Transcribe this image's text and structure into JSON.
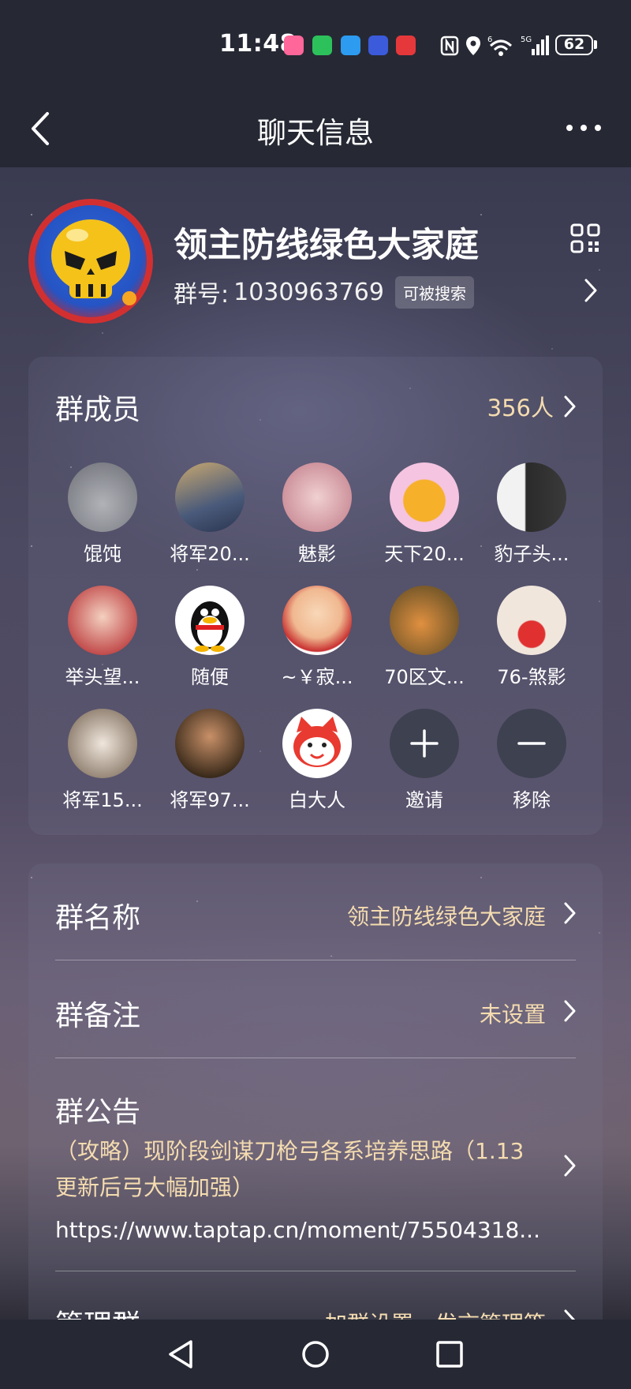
{
  "status_bar": {
    "time": "11:48",
    "app_icons": [
      {
        "name": "bilibili-icon",
        "color": "#ff6699",
        "glyph": "b"
      },
      {
        "name": "wechat-icon",
        "color": "#2dc15c",
        "glyph": "●"
      },
      {
        "name": "message-icon",
        "color": "#2d9bf0",
        "glyph": "●"
      },
      {
        "name": "tieba-icon",
        "color": "#3b5bdb",
        "glyph": "贴"
      },
      {
        "name": "vivo-icon",
        "color": "#e5383b",
        "glyph": "●"
      }
    ],
    "network": "5G",
    "wifi_label": "6",
    "battery": "62"
  },
  "nav": {
    "title": "聊天信息"
  },
  "group": {
    "name": "领主防线绿色大家庭",
    "id_label": "群号:",
    "id_value": "1030963769",
    "search_badge": "可被搜索"
  },
  "members": {
    "title": "群成员",
    "count": "356人",
    "list": [
      {
        "name": "馄饨",
        "color": "#8d8f96"
      },
      {
        "name": "将军20...",
        "color": "#4a5a7a"
      },
      {
        "name": "魅影",
        "color": "#d8a0a8"
      },
      {
        "name": "天下20...",
        "color": "#f3b8d8"
      },
      {
        "name": "豹子头...",
        "color": "#dcdcdc"
      },
      {
        "name": "举头望...",
        "color": "#e8b0a0"
      },
      {
        "name": "随便",
        "color": "#ffffff"
      },
      {
        "name": "~￥寂...",
        "color": "#f0c0a0"
      },
      {
        "name": "70区文...",
        "color": "#9a7a4a"
      },
      {
        "name": "76-煞影",
        "color": "#e8e0d8"
      },
      {
        "name": "将军15...",
        "color": "#c8b8a8"
      },
      {
        "name": "将军97...",
        "color": "#5a4a3a"
      },
      {
        "name": "白大人",
        "color": "#ffffff"
      }
    ],
    "invite_label": "邀请",
    "remove_label": "移除"
  },
  "settings": {
    "group_name_label": "群名称",
    "group_name_value": "领主防线绿色大家庭",
    "group_remark_label": "群备注",
    "group_remark_value": "未设置",
    "announcement_label": "群公告",
    "announcement_text": "（攻略）现阶段剑谋刀枪弓各系培养思路（1.13更新后弓大幅加强）",
    "announcement_link": "https://www.taptap.cn/moment/75504318...",
    "manage_label": "管理群",
    "manage_value": "加群设置、发言管理等"
  },
  "colors": {
    "accent_value": "#f5dcb0",
    "bar_bg": "#262934"
  }
}
